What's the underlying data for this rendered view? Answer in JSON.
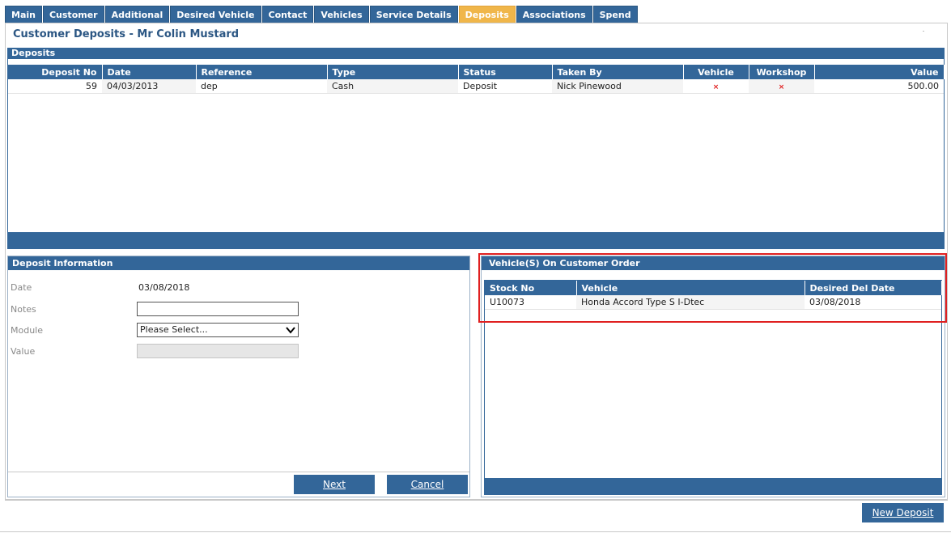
{
  "tabs": [
    {
      "label": "Main"
    },
    {
      "label": "Customer"
    },
    {
      "label": "Additional"
    },
    {
      "label": "Desired Vehicle"
    },
    {
      "label": "Contact"
    },
    {
      "label": "Vehicles"
    },
    {
      "label": "Service Details"
    },
    {
      "label": "Deposits",
      "active": true
    },
    {
      "label": "Associations"
    },
    {
      "label": "Spend"
    }
  ],
  "page_title": "Customer Deposits - Mr Colin Mustard",
  "deposits": {
    "section_title": "Deposits",
    "columns": [
      "Deposit No",
      "Date",
      "Reference",
      "Type",
      "Status",
      "Taken By",
      "Vehicle",
      "Workshop",
      "Value"
    ],
    "rows": [
      {
        "deposit_no": "59",
        "date": "04/03/2013",
        "reference": "dep",
        "type": "Cash",
        "status": "Deposit",
        "taken_by": "Nick Pinewood",
        "vehicle": "×",
        "workshop": "×",
        "value": "500.00"
      }
    ]
  },
  "deposit_info": {
    "title": "Deposit Information",
    "date_label": "Date",
    "date_value": "03/08/2018",
    "notes_label": "Notes",
    "notes_value": "",
    "module_label": "Module",
    "module_selected": "Please Select...",
    "value_label": "Value",
    "next_label": "Next",
    "cancel_label": "Cancel"
  },
  "vehicles_on_order": {
    "title": "Vehicle(S) On Customer Order",
    "columns": [
      "Stock No",
      "Vehicle",
      "Desired Del Date"
    ],
    "rows": [
      {
        "stock_no": "U10073",
        "vehicle": "Honda Accord Type S I-Dtec",
        "desired_del_date": "03/08/2018"
      }
    ]
  },
  "new_deposit_label": "New Deposit",
  "colors": {
    "header_blue": "#336699",
    "active_tab": "#f0b64a",
    "highlight_red": "#e02020"
  }
}
